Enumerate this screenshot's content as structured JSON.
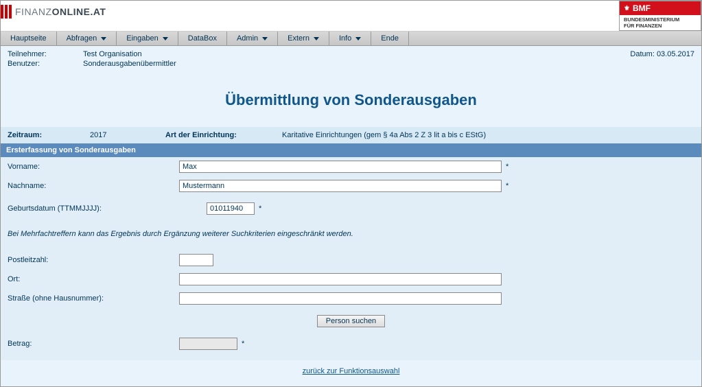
{
  "brand": {
    "text_prefix": "FINANZ",
    "text_suffix": "ONLINE.AT"
  },
  "bmf": {
    "label": "BMF",
    "sub1": "BUNDESMINISTERIUM",
    "sub2": "FÜR FINANZEN"
  },
  "menu": {
    "hauptseite": "Hauptseite",
    "abfragen": "Abfragen",
    "eingaben": "Eingaben",
    "databox": "DataBox",
    "admin": "Admin",
    "extern": "Extern",
    "info": "Info",
    "ende": "Ende"
  },
  "info": {
    "teilnehmer_label": "Teilnehmer:",
    "teilnehmer_value": "Test Organisation",
    "benutzer_label": "Benutzer:",
    "benutzer_value": "Sonderausgabenübermittler",
    "datum_label": "Datum: ",
    "datum_value": "03.05.2017"
  },
  "page_title": "Übermittlung von Sonderausgaben",
  "period": {
    "zeitraum_label": "Zeitraum:",
    "zeitraum_value": "2017",
    "art_label": "Art der Einrichtung:",
    "art_value": "Karitative Einrichtungen (gem § 4a Abs 2 Z 3 lit a bis c EStG)"
  },
  "section_header": "Ersterfassung von Sonderausgaben",
  "form": {
    "vorname_label": "Vorname:",
    "vorname_value": "Max",
    "nachname_label": "Nachname:",
    "nachname_value": "Mustermann",
    "geb_label": "Geburtsdatum (TTMMJJJJ):",
    "geb_value": "01011940",
    "note": "Bei Mehrfachtreffern kann das Ergebnis durch Ergänzung weiterer Suchkriterien eingeschränkt werden.",
    "plz_label": "Postleitzahl:",
    "plz_value": "",
    "ort_label": "Ort:",
    "ort_value": "",
    "strasse_label": "Straße (ohne Hausnummer):",
    "strasse_value": "",
    "search_button": "Person suchen",
    "betrag_label": "Betrag:",
    "betrag_value": ""
  },
  "back_link": "zurück zur Funktionsauswahl",
  "required_marker": "*"
}
